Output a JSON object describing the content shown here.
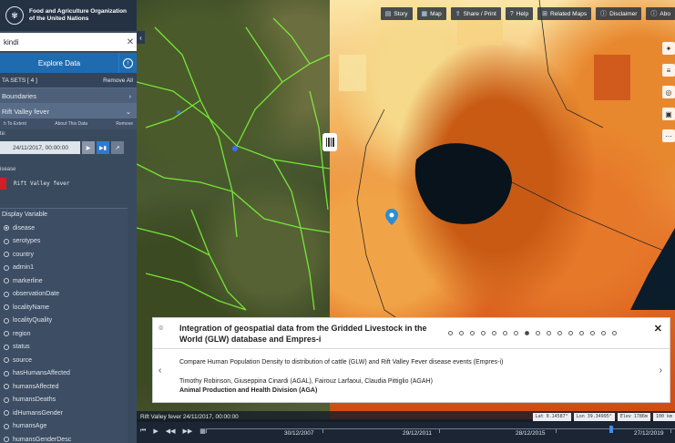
{
  "sidebar": {
    "org_line1": "Food and Agriculture Organization",
    "org_line2": "of the United Nations",
    "search_value": "kindi",
    "explore_label": "Explore Data",
    "datasets_label": "TA SETS  [ 4 ]",
    "remove_all": "Remove All",
    "layers": [
      {
        "label": "Boundaries"
      },
      {
        "label": "Rift Valley fever"
      }
    ],
    "tools": [
      "h To Extent",
      "About This Data",
      "Remove"
    ],
    "date_prefix": "te:",
    "date_value": "24/11/2017, 00:00:00",
    "legend_title": "isease",
    "legend_item": "Rift Valley fever",
    "legend_color": "#d01f25",
    "display_variable_title": "Display Variable",
    "variables": [
      {
        "label": "disease",
        "selected": true
      },
      {
        "label": "serotypes"
      },
      {
        "label": "country"
      },
      {
        "label": "admin1"
      },
      {
        "label": "markerline"
      },
      {
        "label": "observationDate"
      },
      {
        "label": "localityName"
      },
      {
        "label": "localityQuality"
      },
      {
        "label": "region"
      },
      {
        "label": "status"
      },
      {
        "label": "source"
      },
      {
        "label": "hasHumansAffected"
      },
      {
        "label": "humansAffected"
      },
      {
        "label": "humansDeaths"
      },
      {
        "label": "idHumansGender"
      },
      {
        "label": "humansAge"
      },
      {
        "label": "humansGenderDesc"
      }
    ]
  },
  "topbar": {
    "buttons": [
      {
        "label": "Story",
        "icon": "book-icon"
      },
      {
        "label": "Map",
        "icon": "map-icon"
      },
      {
        "label": "Share / Print",
        "icon": "share-icon"
      },
      {
        "label": "Help",
        "icon": "help-icon"
      },
      {
        "label": "Related Maps",
        "icon": "grid-icon"
      },
      {
        "label": "Disclaimer",
        "icon": "info-icon"
      },
      {
        "label": "Abo",
        "icon": "about-icon"
      }
    ]
  },
  "info_panel": {
    "title": "Integration of geospatial data from the Gridded Livestock in the World (GLW) database and Empres-i",
    "description": "Compare Human Population Density to distribution of cattle (GLW) and Rift Valley Fever disease events (Empres-i)",
    "authors": "Timothy Robinson, Giuseppina Cinardi (AGAL), Fairouz Larfaoui, Claudia Pittiglio (AGAH)",
    "division": "Animal Production and Health Division (AGA)",
    "dot_count": 16,
    "active_dot": 7
  },
  "status_bar": {
    "layer_time": "Rift Valley fever 24/11/2017, 00:00:00",
    "lat": "Lat  0.14587°",
    "lon": "Lon  39.34995°",
    "elev": "Elev  1786m",
    "scale": "100 km"
  },
  "timeline": {
    "labels": [
      "30/12/2007",
      "29/12/2011",
      "28/12/2015",
      "27/12/2019"
    ]
  }
}
